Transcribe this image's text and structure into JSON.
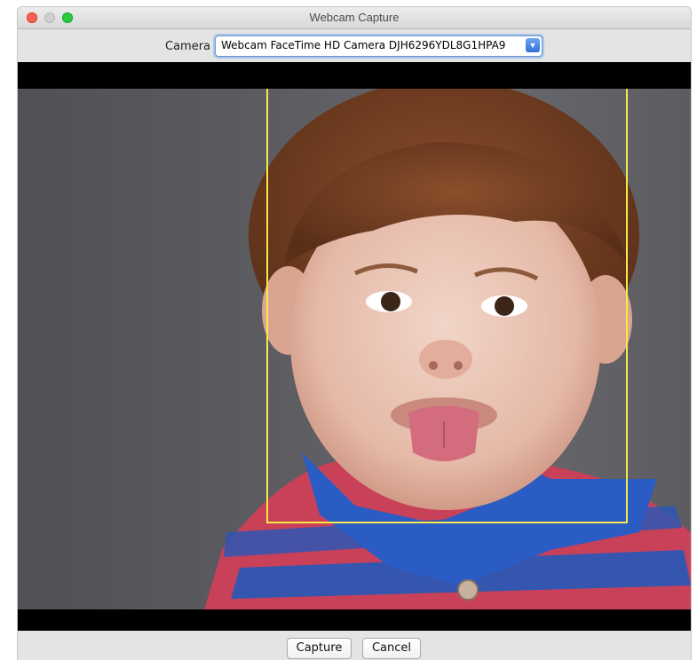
{
  "window": {
    "title": "Webcam Capture"
  },
  "camera": {
    "label": "Camera",
    "selected": "Webcam FaceTime HD Camera DJH6296YDL8G1HPA9"
  },
  "buttons": {
    "capture": "Capture",
    "cancel": "Cancel"
  },
  "preview": {
    "face_box_color": "#f4ea4a",
    "description_icon": "face-detection-box"
  }
}
